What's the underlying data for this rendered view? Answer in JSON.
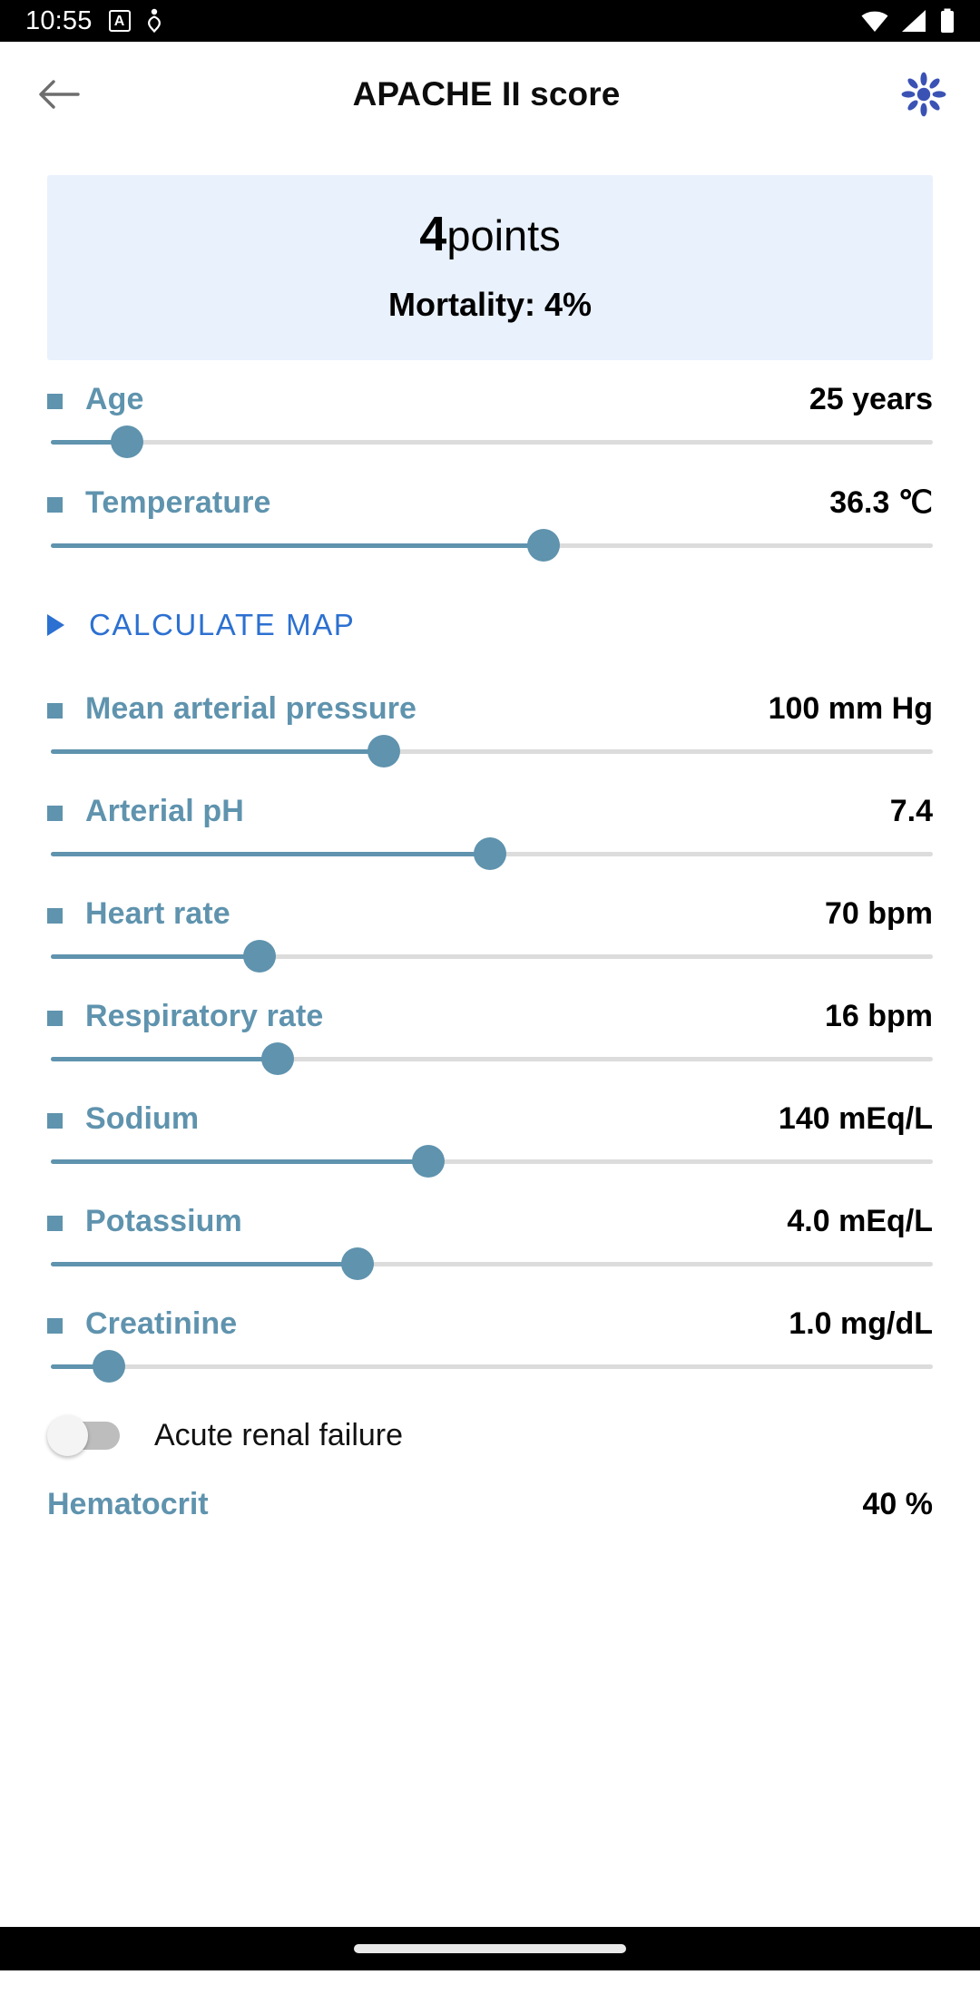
{
  "statusbar": {
    "time": "10:55",
    "icons_left": [
      "app-badge-icon",
      "heart-activity-icon"
    ],
    "icons_right": [
      "wifi-icon",
      "cellular-signal-icon",
      "battery-icon"
    ],
    "app_badge_letter": "A"
  },
  "appbar": {
    "back_icon": "back-arrow-icon",
    "title": "APACHE II score",
    "action_icon": "flower-sparkle-icon"
  },
  "result": {
    "points_value": "4",
    "points_label": "points",
    "mortality": "Mortality: 4%",
    "card_bg": "#e9f1fd"
  },
  "colors": {
    "label_blue": "#5f93ae",
    "link_blue": "#2c70d1",
    "track_inactive": "#dcdcdc",
    "value_black": "#000000"
  },
  "sliders": [
    {
      "label": "Age",
      "value": "25 years",
      "percent": 9
    },
    {
      "label": "Temperature",
      "value": "36.3 ℃",
      "percent": 56
    },
    {
      "label": "Mean arterial pressure",
      "value": "100 mm Hg",
      "percent": 38
    },
    {
      "label": "Arterial pH",
      "value": "7.4",
      "percent": 50
    },
    {
      "label": "Heart rate",
      "value": "70 bpm",
      "percent": 24
    },
    {
      "label": "Respiratory rate",
      "value": "16 bpm",
      "percent": 26
    },
    {
      "label": "Sodium",
      "value": "140 mEq/L",
      "percent": 43
    },
    {
      "label": "Potassium",
      "value": "4.0 mEq/L",
      "percent": 35
    },
    {
      "label": "Creatinine",
      "value": "1.0 mg/dL",
      "percent": 7
    }
  ],
  "calculate_map": {
    "label": "CALCULATE MAP",
    "expander_icon": "triangle-right-icon"
  },
  "toggle": {
    "label": "Acute renal failure",
    "state": "off"
  },
  "clipped_row": {
    "label": "Hematocrit",
    "value": "40 %"
  }
}
